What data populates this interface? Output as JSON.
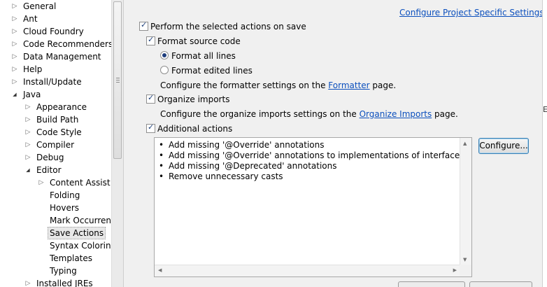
{
  "tree": {
    "items": [
      {
        "label": "General",
        "expander": "collapsed",
        "level": 0
      },
      {
        "label": "Ant",
        "expander": "collapsed",
        "level": 0
      },
      {
        "label": "Cloud Foundry",
        "expander": "collapsed",
        "level": 0
      },
      {
        "label": "Code Recommenders",
        "expander": "collapsed",
        "level": 0
      },
      {
        "label": "Data Management",
        "expander": "collapsed",
        "level": 0
      },
      {
        "label": "Help",
        "expander": "collapsed",
        "level": 0
      },
      {
        "label": "Install/Update",
        "expander": "collapsed",
        "level": 0
      },
      {
        "label": "Java",
        "expander": "expanded",
        "level": 0
      },
      {
        "label": "Appearance",
        "expander": "collapsed",
        "level": 1
      },
      {
        "label": "Build Path",
        "expander": "collapsed",
        "level": 1
      },
      {
        "label": "Code Style",
        "expander": "collapsed",
        "level": 1
      },
      {
        "label": "Compiler",
        "expander": "collapsed",
        "level": 1
      },
      {
        "label": "Debug",
        "expander": "collapsed",
        "level": 1
      },
      {
        "label": "Editor",
        "expander": "expanded",
        "level": 1
      },
      {
        "label": "Content Assist",
        "expander": "collapsed",
        "level": 2
      },
      {
        "label": "Folding",
        "expander": "none",
        "level": 2
      },
      {
        "label": "Hovers",
        "expander": "none",
        "level": 2
      },
      {
        "label": "Mark Occurrences",
        "expander": "none",
        "level": 2
      },
      {
        "label": "Save Actions",
        "expander": "none",
        "level": 2,
        "selected": true
      },
      {
        "label": "Syntax Coloring",
        "expander": "none",
        "level": 2
      },
      {
        "label": "Templates",
        "expander": "none",
        "level": 2
      },
      {
        "label": "Typing",
        "expander": "none",
        "level": 2
      },
      {
        "label": "Installed JREs",
        "expander": "collapsed",
        "level": 1
      }
    ]
  },
  "header": {
    "project_link": "Configure Project Specific Settings..."
  },
  "options": {
    "perform_on_save": {
      "label": "Perform the selected actions on save",
      "checked": true
    },
    "format_source": {
      "label": "Format source code",
      "checked": true
    },
    "format_all_lines": {
      "label": "Format all lines",
      "selected": true
    },
    "format_edited_lines": {
      "label": "Format edited lines",
      "selected": false
    },
    "formatter_note": {
      "prefix": "Configure the formatter settings on the ",
      "link": "Formatter",
      "suffix": " page."
    },
    "organize_imports": {
      "label": "Organize imports",
      "checked": true
    },
    "organize_note": {
      "prefix": "Configure the organize imports settings on the ",
      "link": "Organize Imports",
      "suffix": " page."
    },
    "additional_actions": {
      "label": "Additional actions",
      "checked": true
    }
  },
  "actions_list": [
    "Add missing '@Override' annotations",
    "Add missing '@Override' annotations to implementations of interface methods",
    "Add missing '@Deprecated' annotations",
    "Remove unnecessary casts"
  ],
  "configure_button": "Configure...",
  "bullet": "•",
  "truncated_right_glyph": "E:",
  "icons": {
    "collapsed": "▷",
    "expanded": "◢",
    "scroll_up": "▲",
    "scroll_down": "▼",
    "scroll_left": "◀",
    "scroll_right": "▶"
  },
  "colors": {
    "link": "#0b4fbd",
    "selection": "#e8e8e8",
    "focus_border": "#3c7fb1"
  }
}
